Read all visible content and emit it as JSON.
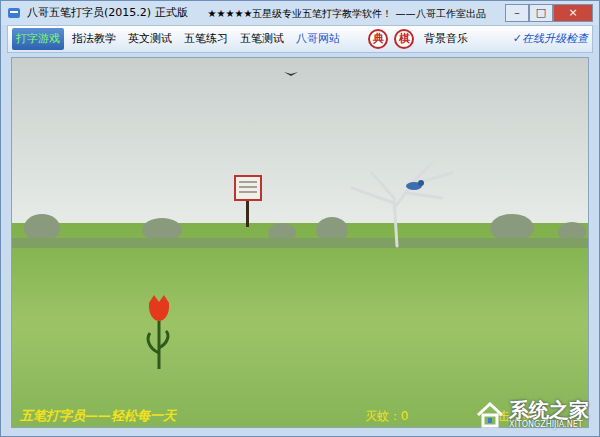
{
  "window": {
    "title": "八哥五笔打字员(2015.2) 正式版",
    "subtitle": "★★★★★五星级专业五笔打字教学软件！ ——八哥工作室出品",
    "controls": [
      "–",
      "□",
      "×"
    ]
  },
  "tabs": [
    {
      "label": "打字游戏",
      "selected": true,
      "kind": "tab"
    },
    {
      "label": "指法教学",
      "selected": false,
      "kind": "tab"
    },
    {
      "label": "英文测试",
      "selected": false,
      "kind": "tab"
    },
    {
      "label": "五笔练习",
      "selected": false,
      "kind": "tab"
    },
    {
      "label": "五笔测试",
      "selected": false,
      "kind": "tab"
    },
    {
      "label": "八哥网站",
      "selected": false,
      "kind": "link"
    }
  ],
  "round_buttons": [
    "典",
    "棋"
  ],
  "music": "背景音乐",
  "update": "✓在线升级检查",
  "game": {
    "slogan": "五笔打字员——轻松每一天",
    "stats": [
      {
        "label": "灭蚊：",
        "value": "0"
      },
      {
        "label": "击：",
        "value": "0"
      }
    ]
  },
  "watermark": {
    "name": "系统之家",
    "url": "XITONGZHIJIA.NET"
  }
}
